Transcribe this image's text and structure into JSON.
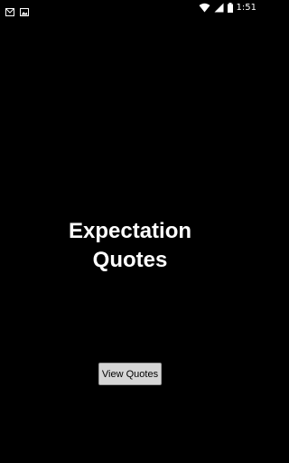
{
  "status_bar": {
    "left_icons": [
      "gmail-icon",
      "image-icon"
    ],
    "right_icons": [
      "wifi-icon",
      "signal-icon",
      "battery-icon"
    ],
    "time": "1:51"
  },
  "main": {
    "title_line1": "Expectation",
    "title_line2": "Quotes",
    "button_label": "View Quotes"
  },
  "colors": {
    "background": "#000000",
    "text": "#ffffff",
    "button_bg": "#d6d6d6"
  }
}
